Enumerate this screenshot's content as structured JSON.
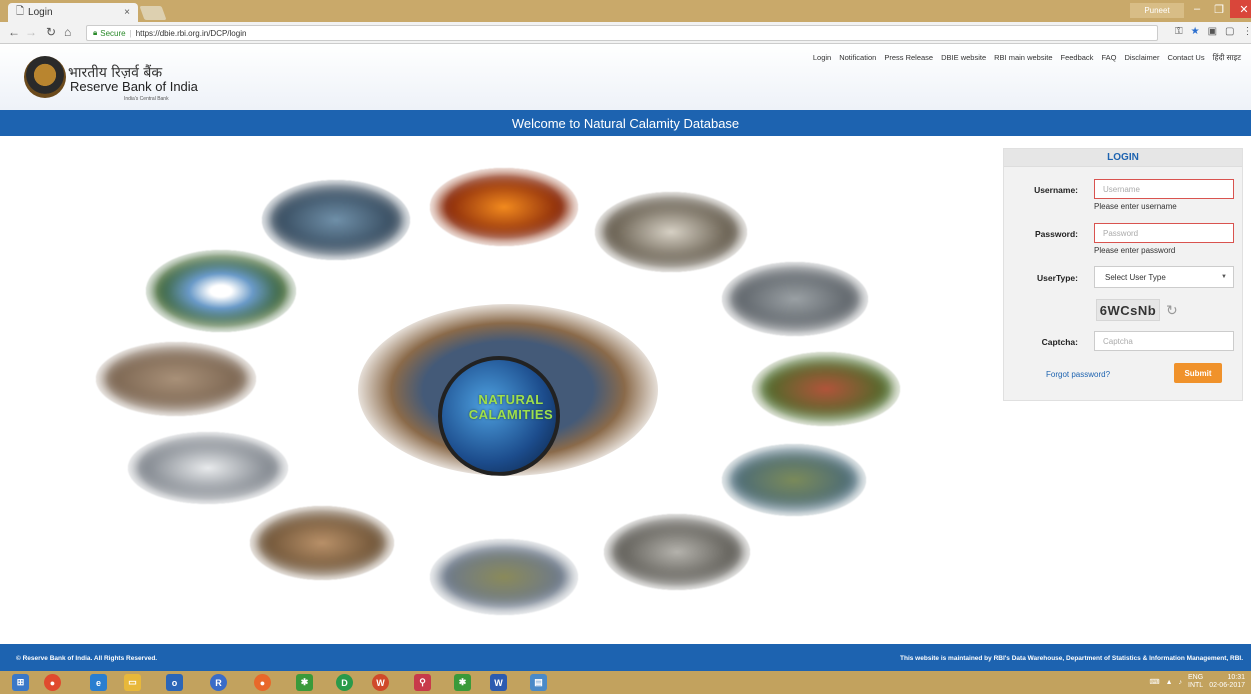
{
  "browser": {
    "tab_title": "Login",
    "tab_close": "×",
    "user_name": "Puneet",
    "secure_label": "Secure",
    "url": "https://dbie.rbi.org.in/DCP/login"
  },
  "header": {
    "logo_hindi": "भारतीय रिज़र्व बैंक",
    "logo_english": "Reserve Bank of India",
    "logo_tagline": "India's Central Bank",
    "nav": [
      "Login",
      "Notification",
      "Press Release",
      "DBIE website",
      "RBI main website",
      "Feedback",
      "FAQ",
      "Disclaimer",
      "Contact Us",
      "हिंदी साइट"
    ]
  },
  "welcome": "Welcome to Natural Calamity Database",
  "collage": {
    "title_line1": "NATURAL",
    "title_line2": "CALAMITIES"
  },
  "login": {
    "heading": "LOGIN",
    "username_label": "Username:",
    "username_placeholder": "Username",
    "username_hint": "Please enter username",
    "password_label": "Password:",
    "password_placeholder": "Password",
    "password_hint": "Please enter password",
    "usertype_label": "UserType:",
    "usertype_selected": "Select User Type",
    "captcha_code": "6WCsNb",
    "captcha_label": "Captcha:",
    "captcha_placeholder": "Captcha",
    "forgot": "Forgot password?",
    "submit": "Submit"
  },
  "footer": {
    "left": "© Reserve Bank of India. All Rights Reserved.",
    "right": "This website is maintained by RBI's Data Warehouse, Department of Statistics & Information Management, RBI."
  },
  "taskbar": {
    "lang": "ENG",
    "layout": "INTL",
    "time": "10:31",
    "date": "02-06-2017"
  },
  "colors": {
    "brand_blue": "#1d63b0",
    "submit_orange": "#f0922b",
    "error_red": "#d9534f"
  }
}
